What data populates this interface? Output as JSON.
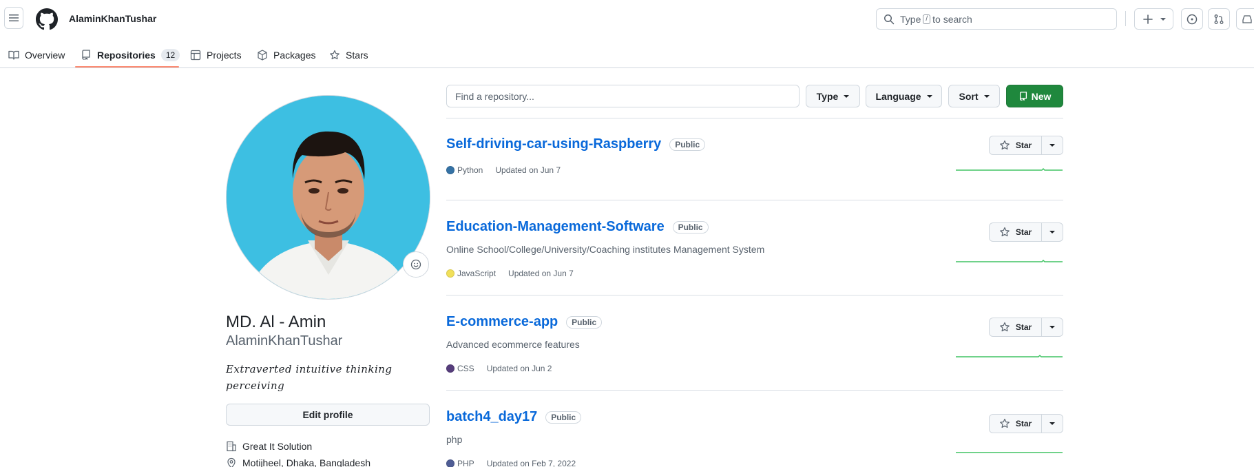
{
  "header": {
    "username": "AlaminKhanTushar",
    "search": {
      "prefix": "Type",
      "key": "/",
      "suffix": "to search"
    }
  },
  "nav": {
    "tabs": [
      {
        "label": "Overview",
        "icon": "book-icon"
      },
      {
        "label": "Repositories",
        "icon": "repo-icon",
        "count": "12",
        "active": true
      },
      {
        "label": "Projects",
        "icon": "table-icon"
      },
      {
        "label": "Packages",
        "icon": "package-icon"
      },
      {
        "label": "Stars",
        "icon": "star-icon"
      }
    ]
  },
  "profile": {
    "full_name": "MD. Al - Amin",
    "login": "AlaminKhanTushar",
    "bio": "Extraverted intuitive thinking perceiving",
    "edit_label": "Edit profile",
    "company": "Great It Solution",
    "location": "Motijheel, Dhaka, Bangladesh"
  },
  "filters": {
    "search_placeholder": "Find a repository...",
    "type_label": "Type",
    "language_label": "Language",
    "sort_label": "Sort",
    "new_label": "New",
    "new_color": "#1f883d"
  },
  "repos": [
    {
      "name": "Self-driving-car-using-Raspberry",
      "visibility": "Public",
      "description": "",
      "language": "Python",
      "language_color": "#3572A5",
      "updated": "Updated on Jun 7",
      "star_label": "Star"
    },
    {
      "name": "Education-Management-Software",
      "visibility": "Public",
      "description": "Online School/College/University/Coaching institutes Management System",
      "language": "JavaScript",
      "language_color": "#f1e05a",
      "updated": "Updated on Jun 7",
      "star_label": "Star"
    },
    {
      "name": "E-commerce-app",
      "visibility": "Public",
      "description": "Advanced ecommerce features",
      "language": "CSS",
      "language_color": "#563d7c",
      "updated": "Updated on Jun 2",
      "star_label": "Star"
    },
    {
      "name": "batch4_day17",
      "visibility": "Public",
      "description": "php",
      "language": "PHP",
      "language_color": "#4F5D95",
      "updated": "Updated on Feb 7, 2022",
      "star_label": "Star"
    }
  ],
  "colors": {
    "link": "#0969da",
    "activity": "#40c463",
    "tab_underline": "#fd8c73"
  }
}
